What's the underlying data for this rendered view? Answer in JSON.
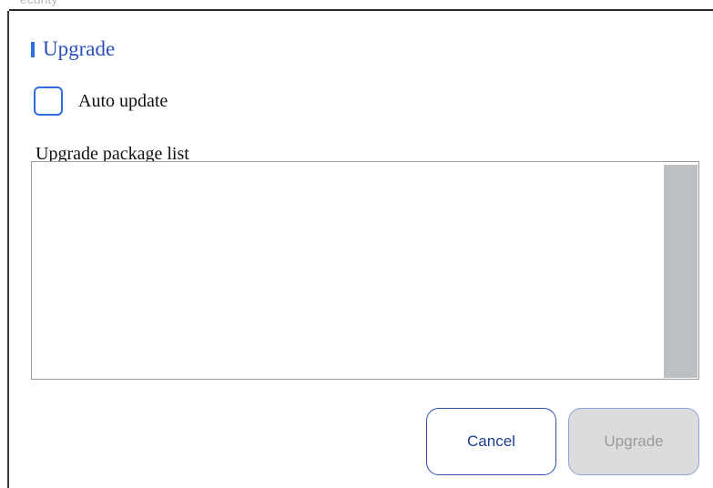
{
  "background": {
    "title_tail": "ecurity"
  },
  "dialog": {
    "title": "Upgrade",
    "auto_update_label": "Auto update",
    "auto_update_checked": false,
    "package_list_label": "Upgrade package list",
    "packages": [],
    "cancel_label": "Cancel",
    "upgrade_label": "Upgrade",
    "upgrade_enabled": false
  },
  "colors": {
    "accent": "#2f6fe0",
    "title_text": "#2b4fb8",
    "disabled_button_bg": "#dcdcdc",
    "scrollbar": "#bcc0c3"
  }
}
